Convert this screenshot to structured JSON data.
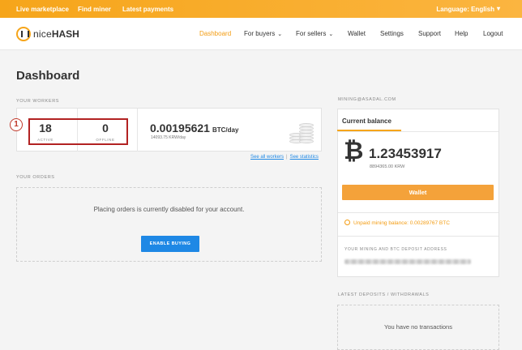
{
  "topbar": {
    "links": [
      "Live marketplace",
      "Find miner",
      "Latest payments"
    ],
    "language": "Language: English"
  },
  "nav": {
    "logo_nice": "nice",
    "logo_hash": "HASH",
    "items": [
      "Dashboard",
      "For buyers",
      "For sellers",
      "Wallet",
      "Settings",
      "Support",
      "Help",
      "Logout"
    ],
    "active": "Dashboard"
  },
  "page": {
    "title": "Dashboard"
  },
  "workers": {
    "section_label": "YOUR WORKERS",
    "active_count": "18",
    "active_label": "ACTIVE",
    "offline_count": "0",
    "offline_label": "OFFLINE",
    "btc_per_day": "0.00195621",
    "btc_per_day_unit": "BTC/day",
    "krw_per_day": "14093.75 KRW/day",
    "link_all_workers": "See all workers",
    "link_separator": "|",
    "link_statistics": "See statistics",
    "annotation_badge": "1"
  },
  "orders": {
    "section_label": "YOUR ORDERS",
    "message": "Placing orders is currently disabled for your account.",
    "enable_button": "ENABLE BUYING"
  },
  "account": {
    "email_label": "MINING@ASADAL.COM",
    "tab_label": "Current balance",
    "balance_btc": "1.23453917",
    "balance_krw": "8894365.00 KRW",
    "wallet_button": "Wallet",
    "unpaid_text": "Unpaid mining balance: 0.00289767 BTC",
    "address_label": "YOUR MINING AND BTC DEPOSIT ADDRESS"
  },
  "deposits": {
    "section_label": "LATEST DEPOSITS / WITHDRAWALS",
    "message": "You have no transactions"
  },
  "colors": {
    "brand_orange": "#f6a51a",
    "link_blue": "#1e88e5",
    "annotation_red": "#b22222"
  }
}
